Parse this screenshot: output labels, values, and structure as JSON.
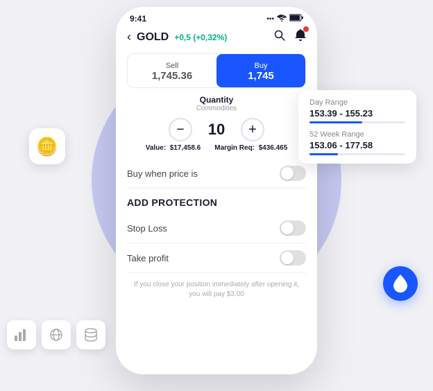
{
  "scene": {
    "statusBar": {
      "time": "9:41",
      "signal": "●●●",
      "wifi": "WiFi",
      "battery": "🔋"
    },
    "header": {
      "backIcon": "‹",
      "title": "GOLD",
      "change": "+0,5 (+0,32%)",
      "searchIcon": "🔍",
      "bellIcon": "🔔"
    },
    "tabs": [
      {
        "label": "Sell",
        "price": "1,745.36",
        "active": false
      },
      {
        "label": "Buy",
        "price": "1,745",
        "active": true
      }
    ],
    "quantity": {
      "label": "Quantity",
      "sublabel": "Commodities",
      "value": "10",
      "minusIcon": "−",
      "plusIcon": "+",
      "valueLabel": "Value:",
      "valueAmount": "$17,458.6",
      "marginLabel": "Margin Req:",
      "marginAmount": "$436.465"
    },
    "toggleRows": [
      {
        "label": "Buy when price is",
        "enabled": false
      },
      {
        "label": "Stop Loss",
        "enabled": false
      },
      {
        "label": "Take profit",
        "enabled": false
      }
    ],
    "addProtectionTitle": "ADD PROTECTION",
    "footerNote": "If you close your position immediately after opening it, you will pay $3.00",
    "infoCard": {
      "rows": [
        {
          "label": "Day Range",
          "value": "153.39 - 155.23",
          "fillPercent": 55
        },
        {
          "label": "52 Week Range",
          "value": "153.06 - 177.58",
          "fillPercent": 30
        }
      ]
    },
    "leftIcons": [
      {
        "icon": "📊",
        "name": "chart-icon"
      },
      {
        "icon": "🌐",
        "name": "network-icon"
      },
      {
        "icon": "🗄️",
        "name": "data-icon"
      }
    ],
    "goldIcon": "🪙",
    "dropletIcon": "💧",
    "colors": {
      "accent": "#1a56ff",
      "positive": "#00b386",
      "negative": "#e53935"
    }
  }
}
